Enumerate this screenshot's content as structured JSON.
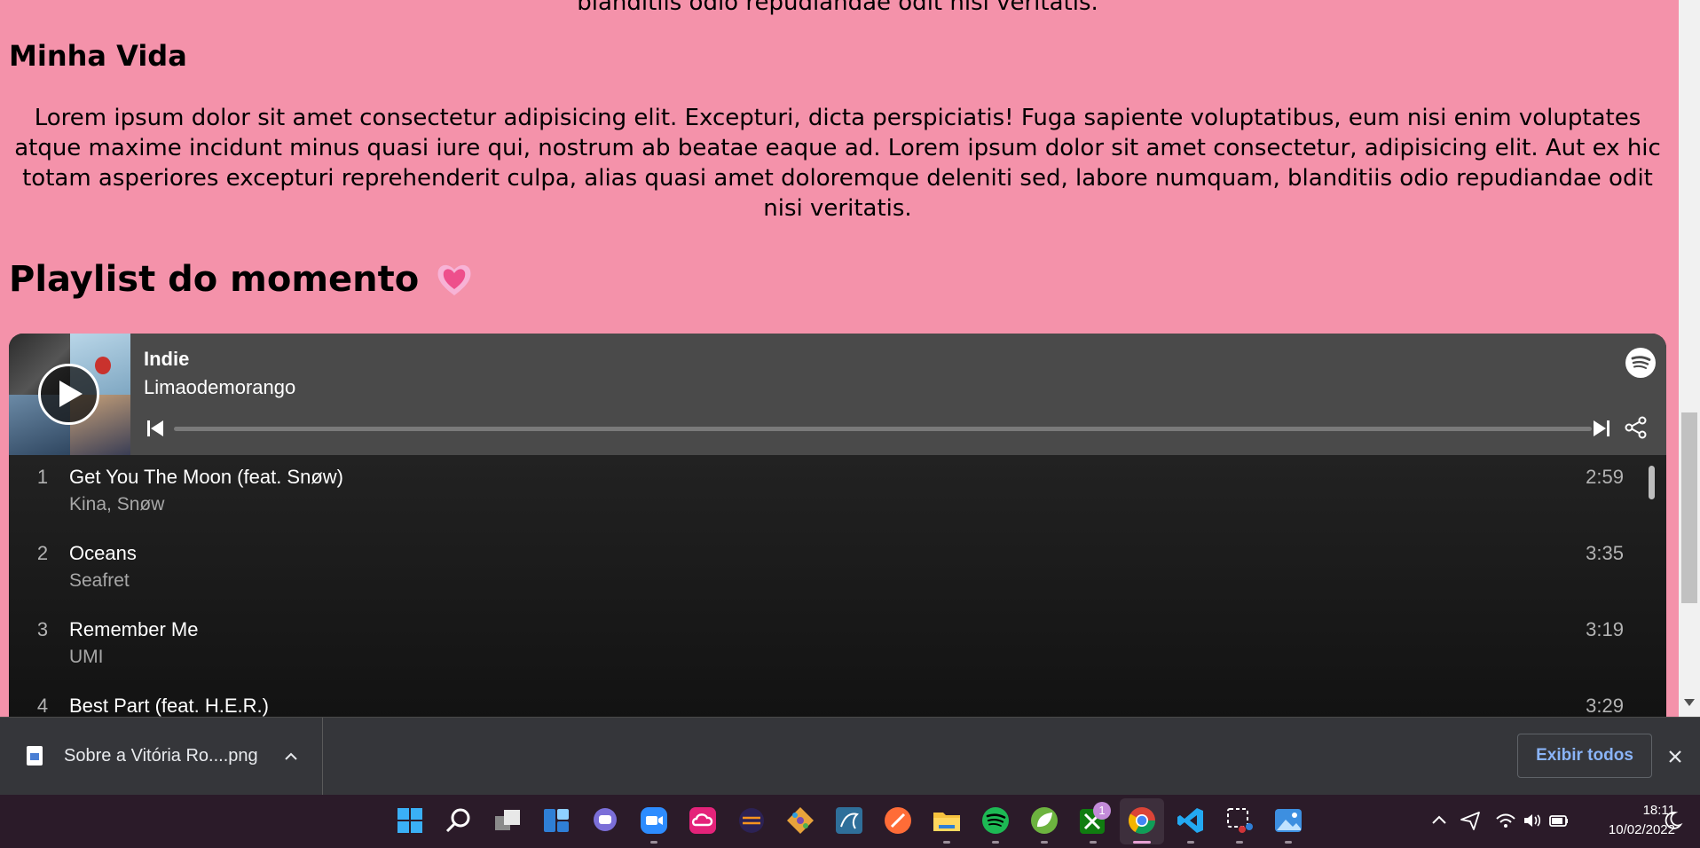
{
  "page": {
    "cut_line": "blanditiis odio repudiandae odit nisi veritatis.",
    "section_title": "Minha Vida",
    "paragraph": "Lorem ipsum dolor sit amet consectetur adipisicing elit. Excepturi, dicta perspiciatis! Fuga sapiente voluptatibus, eum nisi enim voluptates atque maxime incidunt minus quasi iure qui, nostrum ab beatae eaque ad. Lorem ipsum dolor sit amet consectetur, adipisicing elit. Aut ex hic totam asperiores excepturi reprehenderit culpa, alias quasi amet doloremque deleniti sed, labore numquam, blanditiis odio repudiandae odit nisi veritatis.",
    "playlist_title": "Playlist do momento",
    "heart_icon": "pink-heart-icon"
  },
  "embed": {
    "playlist_name": "Indie",
    "owner": "Limaodemorango",
    "brand_color": "#1db954",
    "icons": [
      "play-icon",
      "spotify-logo-icon",
      "skip-previous-icon",
      "skip-next-icon",
      "share-icon"
    ],
    "progress": 0,
    "tracks": [
      {
        "num": "1",
        "title": "Get You The Moon (feat. Snøw)",
        "artist": "Kina, Snøw",
        "duration": "2:59"
      },
      {
        "num": "2",
        "title": "Oceans",
        "artist": "Seafret",
        "duration": "3:35"
      },
      {
        "num": "3",
        "title": "Remember Me",
        "artist": "UMI",
        "duration": "3:19"
      },
      {
        "num": "4",
        "title": "Best Part (feat. H.E.R.)",
        "artist": "",
        "duration": "3:29"
      }
    ]
  },
  "download_bar": {
    "file_name": "Sobre a Vitória Ro....png",
    "show_all_label": "Exibir todos"
  },
  "taskbar": {
    "apps": [
      "windows-start",
      "search",
      "task-view",
      "widgets",
      "teams-chat",
      "zoom",
      "creative-cloud",
      "eclipse",
      "git",
      "mysql-workbench",
      "postman",
      "file-explorer",
      "spotify",
      "spring-tools",
      "xbox",
      "chrome",
      "vscode",
      "snipping-tool",
      "photos"
    ],
    "xbox_badge": "1",
    "time": "18:11",
    "date": "10/02/2022"
  }
}
